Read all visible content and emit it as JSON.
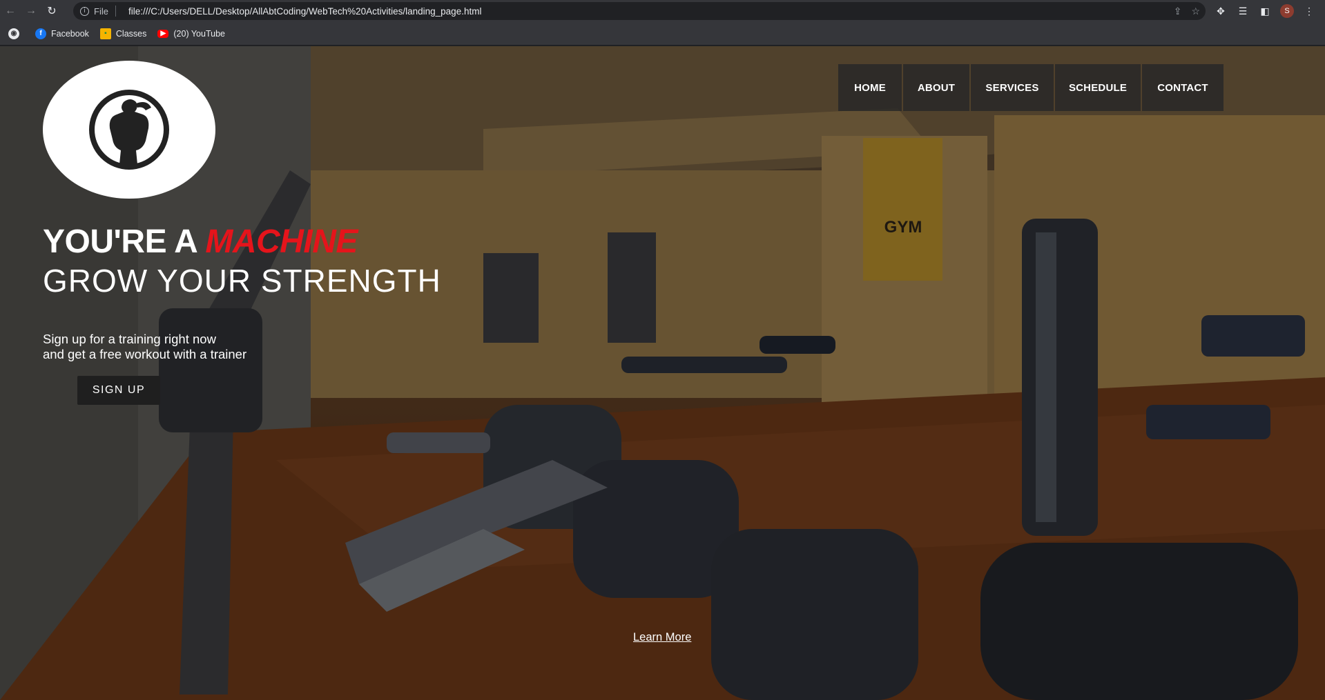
{
  "browser": {
    "url": "file:///C:/Users/DELL/Desktop/AllAbtCoding/WebTech%20Activities/landing_page.html",
    "site_info_label": "File",
    "profile_initial": "S",
    "bookmarks": [
      {
        "label": "Facebook",
        "icon": "facebook-icon"
      },
      {
        "label": "Classes",
        "icon": "classes-icon"
      },
      {
        "label": "(20) YouTube",
        "icon": "youtube-icon"
      }
    ]
  },
  "page": {
    "nav": [
      "HOME",
      "ABOUT",
      "SERVICES",
      "SCHEDULE",
      "CONTACT"
    ],
    "headline_prefix": "YOU'RE A ",
    "headline_accent": "MACHINE",
    "subheadline": "GROW YOUR STRENGTH",
    "pitch_line1": "Sign up for a training right now",
    "pitch_line2": "and get a free workout with a trainer",
    "signup_label": "SIGN UP",
    "learn_more_label": "Learn More",
    "wall_sign": "GYM",
    "accent_color": "#e5141b"
  }
}
